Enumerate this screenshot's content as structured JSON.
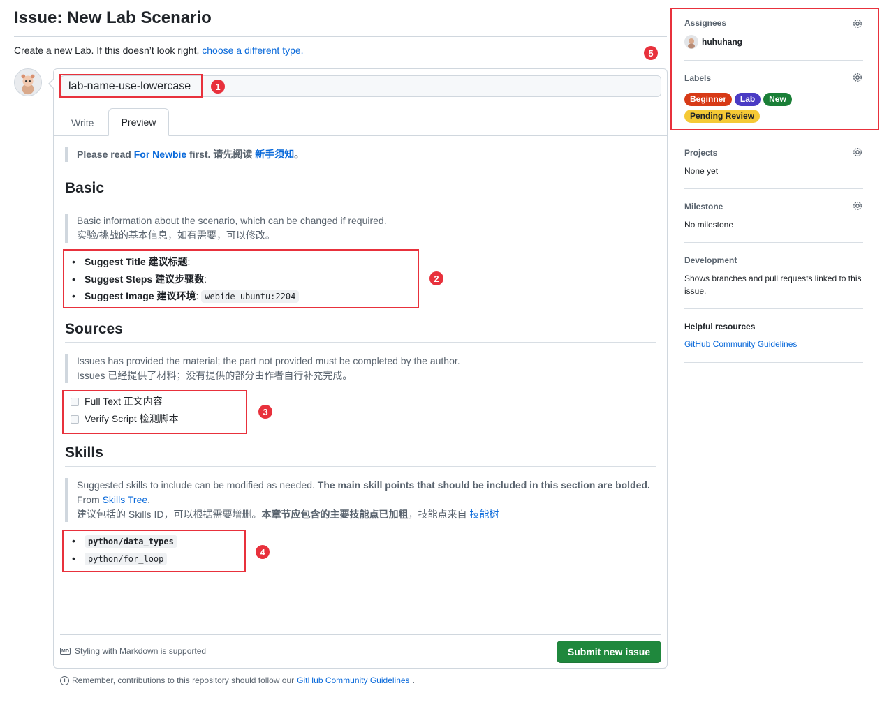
{
  "page": {
    "title": "Issue: New Lab Scenario",
    "subtitle_text": "Create a new Lab. If this doesn’t look right,",
    "subtitle_link": "choose a different type."
  },
  "editor": {
    "title_value": "lab-name-use-lowercase",
    "tabs": [
      {
        "label": "Write",
        "active": false
      },
      {
        "label": "Preview",
        "active": true
      }
    ],
    "intro": {
      "prefix": "Please read",
      "link1": "For Newbie",
      "middle": "first. 请先阅读",
      "link2": "新手须知",
      "suffix": "。"
    },
    "basic": {
      "heading": "Basic",
      "quote_line1": "Basic information about the scenario, which can be changed if required.",
      "quote_line2": "实验/挑战的基本信息，如有需要，可以修改。",
      "items": [
        {
          "label": "Suggest Title 建议标题",
          "sep": ":",
          "code": ""
        },
        {
          "label": "Suggest Steps 建议步骤数",
          "sep": ":",
          "code": ""
        },
        {
          "label": "Suggest Image 建议环境",
          "sep": ":",
          "code": "webide-ubuntu:2204"
        }
      ]
    },
    "sources": {
      "heading": "Sources",
      "quote_line1": "Issues has provided the material; the part not provided must be completed by the author.",
      "quote_line2": "Issues 已经提供了材料；没有提供的部分由作者自行补充完成。",
      "checkboxes": [
        {
          "label": "Full Text 正文内容",
          "checked": false
        },
        {
          "label": "Verify Script 检测脚本",
          "checked": false
        }
      ]
    },
    "skills": {
      "heading": "Skills",
      "quote_a": "Suggested skills to include can be modified as needed.",
      "quote_b_bold": "The main skill points that should be included in this section are bolded.",
      "quote_c": "From",
      "quote_c_link": "Skills Tree",
      "quote_c_end": ".",
      "quote_cn_a": "建议包括的 Skills ID，可以根据需要增删。",
      "quote_cn_bold": "本章节应包含的主要技能点已加粗",
      "quote_cn_b": "，技能点来自",
      "quote_cn_link": "技能树",
      "items": [
        {
          "code": "python/data_types",
          "bold": true
        },
        {
          "code": "python/for_loop",
          "bold": false
        }
      ]
    },
    "footer": {
      "md_icon": "MD",
      "markdown_note": "Styling with Markdown is supported",
      "submit_label": "Submit new issue"
    }
  },
  "remember": {
    "text": "Remember, contributions to this repository should follow our",
    "link": "GitHub Community Guidelines",
    "end": "."
  },
  "annotations": [
    "1",
    "2",
    "3",
    "4",
    "5"
  ],
  "sidebar": {
    "assignees": {
      "heading": "Assignees",
      "user": "huhuhang"
    },
    "labels": {
      "heading": "Labels",
      "items": [
        {
          "name": "Beginner",
          "color": "#d73a17",
          "text": "#ffffff"
        },
        {
          "name": "Lab",
          "color": "#4a3bc4",
          "text": "#ffffff"
        },
        {
          "name": "New",
          "color": "#1a7f37",
          "text": "#ffffff"
        },
        {
          "name": "Pending Review",
          "color": "#f5c935",
          "text": "#1f2328"
        }
      ]
    },
    "projects": {
      "heading": "Projects",
      "value": "None yet"
    },
    "milestone": {
      "heading": "Milestone",
      "value": "No milestone"
    },
    "development": {
      "heading": "Development",
      "value": "Shows branches and pull requests linked to this issue."
    },
    "helpful": {
      "heading": "Helpful resources",
      "link": "GitHub Community Guidelines"
    }
  },
  "colors": {
    "accent_red": "#e8313c",
    "link": "#0969da",
    "submit": "#1f883d"
  }
}
